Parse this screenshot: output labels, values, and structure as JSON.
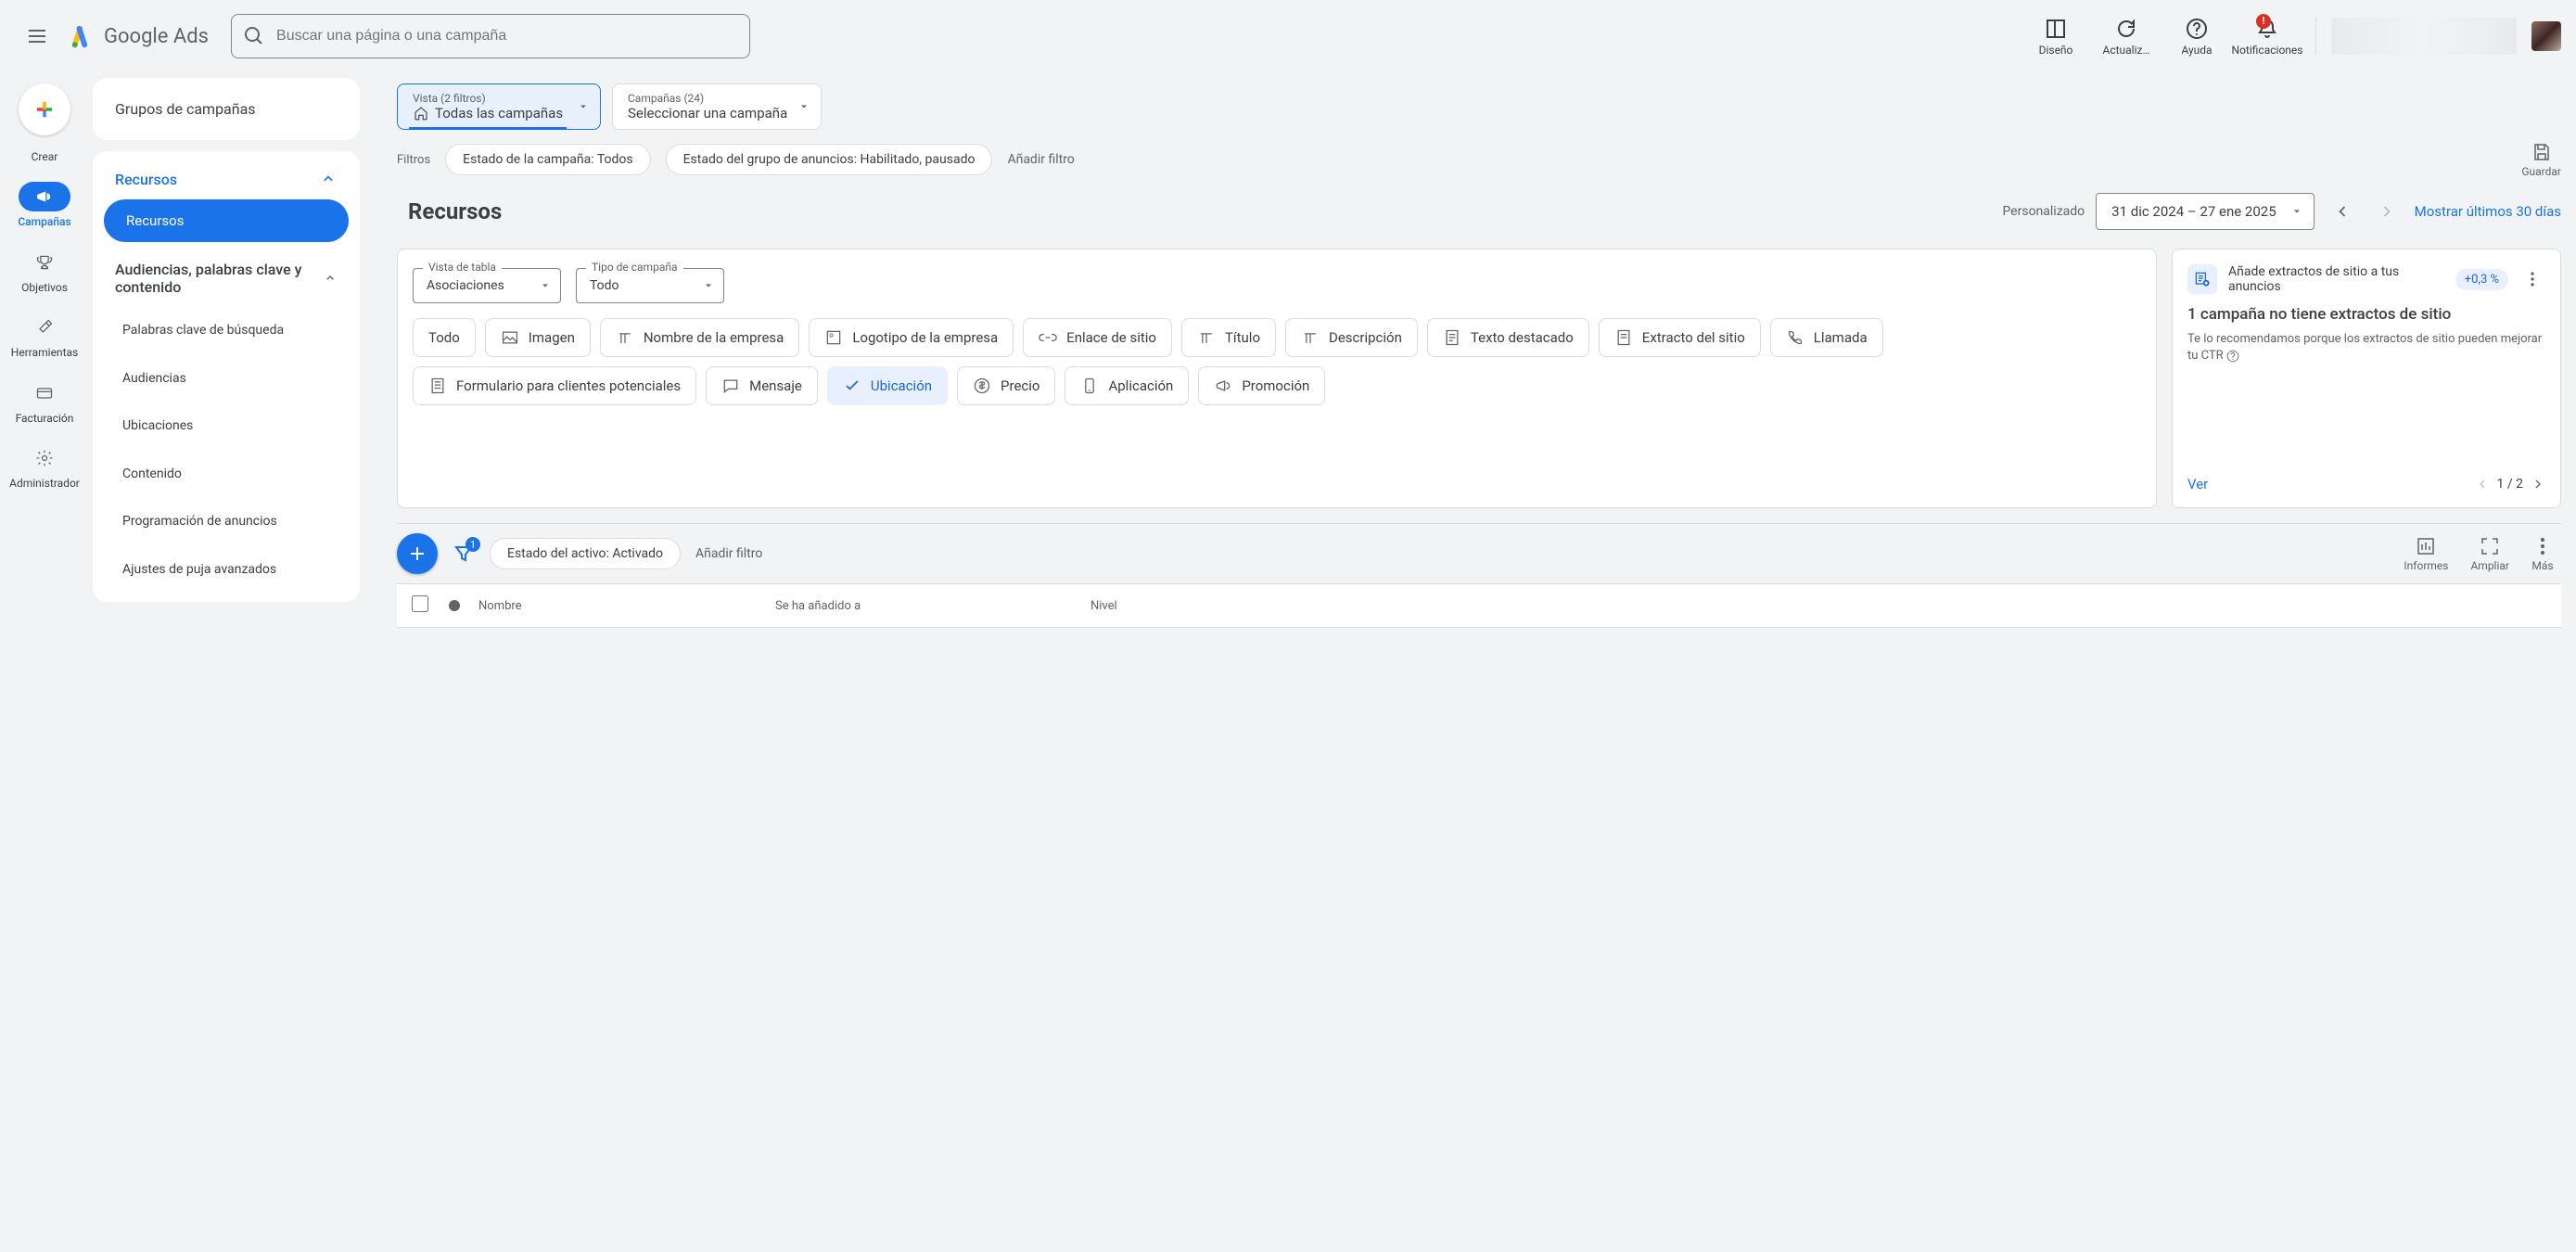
{
  "header": {
    "logo_text": "Google Ads",
    "search_placeholder": "Buscar una página o una campaña",
    "tools": {
      "design": "Diseño",
      "updates": "Actualiz…",
      "help": "Ayuda",
      "notifications": "Notificaciones",
      "notif_badge": "!"
    }
  },
  "rail": {
    "create": "Crear",
    "campaigns": "Campañas",
    "goals": "Objetivos",
    "tools": "Herramientas",
    "billing": "Facturación",
    "admin": "Administrador"
  },
  "side": {
    "groups": "Grupos de campañas",
    "resources_section": "Recursos",
    "resources_pill": "Recursos",
    "audiences_section": "Audiencias, palabras clave y contenido",
    "items": {
      "keywords": "Palabras clave de búsqueda",
      "audiences": "Audiencias",
      "placements": "Ubicaciones",
      "content": "Contenido",
      "scheduling": "Programación de anuncios",
      "bids": "Ajustes de puja avanzados"
    }
  },
  "crumbs": {
    "view_top": "Vista (2 filtros)",
    "view_bottom": "Todas las campañas",
    "camp_top": "Campañas (24)",
    "camp_bottom": "Seleccionar una campaña"
  },
  "filters": {
    "label": "Filtros",
    "chip1": "Estado de la campaña: Todos",
    "chip2": "Estado del grupo de anuncios: Habilitado, pausado",
    "add": "Añadir filtro",
    "save": "Guardar"
  },
  "page": {
    "title": "Recursos",
    "date_label": "Personalizado",
    "date_range": "31 dic 2024 – 27 ene 2025",
    "last30": "Mostrar últimos 30 días"
  },
  "selects": {
    "table_view_label": "Vista de tabla",
    "table_view_value": "Asociaciones",
    "campaign_type_label": "Tipo de campaña",
    "campaign_type_value": "Todo"
  },
  "chips": {
    "all": "Todo",
    "image": "Imagen",
    "business_name": "Nombre de la empresa",
    "business_logo": "Logotipo de la empresa",
    "sitelink": "Enlace de sitio",
    "headline": "Título",
    "description": "Descripción",
    "callout": "Texto destacado",
    "snippet": "Extracto del sitio",
    "call": "Llamada",
    "leadform": "Formulario para clientes potenciales",
    "message": "Mensaje",
    "location": "Ubicación",
    "price": "Precio",
    "app": "Aplicación",
    "promotion": "Promoción"
  },
  "recom": {
    "title": "Añade extractos de sitio a tus anuncios",
    "badge": "+0,3 %",
    "subtitle": "1 campaña no tiene extractos de sitio",
    "text": "Te lo recomendamos porque los extractos de sitio pueden mejorar tu CTR",
    "view": "Ver",
    "pager": "1 / 2"
  },
  "toolbar2": {
    "filter_count": "1",
    "active_chip": "Estado del activo: Activado",
    "add_filter": "Añadir filtro",
    "reports": "Informes",
    "expand": "Ampliar",
    "more": "Más"
  },
  "table": {
    "name": "Nombre",
    "added_to": "Se ha añadido a",
    "level": "Nivel"
  }
}
